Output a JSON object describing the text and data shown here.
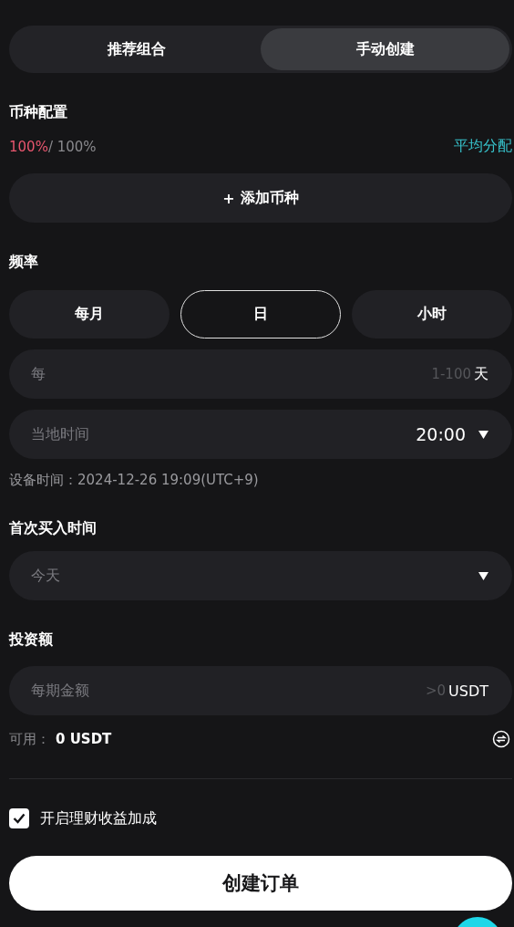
{
  "mode_tabs": [
    {
      "label": "推荐组合",
      "selected": false
    },
    {
      "label": "手动创建",
      "selected": true
    }
  ],
  "allocation": {
    "title": "币种配置",
    "used": "100%",
    "total": "/ 100%",
    "even_split": "平均分配",
    "add_button": {
      "icon": "+",
      "label": "添加币种"
    }
  },
  "frequency": {
    "title": "频率",
    "options": [
      {
        "label": "每月",
        "selected": false
      },
      {
        "label": "日",
        "selected": true
      },
      {
        "label": "小时",
        "selected": false
      }
    ],
    "interval_field": {
      "placeholder": "每",
      "hint": "1-100",
      "unit": "天"
    },
    "time_field": {
      "label": "当地时间",
      "value": "20:00"
    },
    "device_time": "设备时间：2024-12-26 19:09(UTC+9)"
  },
  "first_buy": {
    "title": "首次买入时间",
    "value": "今天"
  },
  "investment": {
    "title": "投资额",
    "placeholder": "每期金额",
    "hint": ">0",
    "unit": "USDT",
    "available_label": "可用：",
    "available_value": "0 USDT"
  },
  "bonus": {
    "label": "开启理财收益加成",
    "checked": true
  },
  "submit": "创建订单"
}
